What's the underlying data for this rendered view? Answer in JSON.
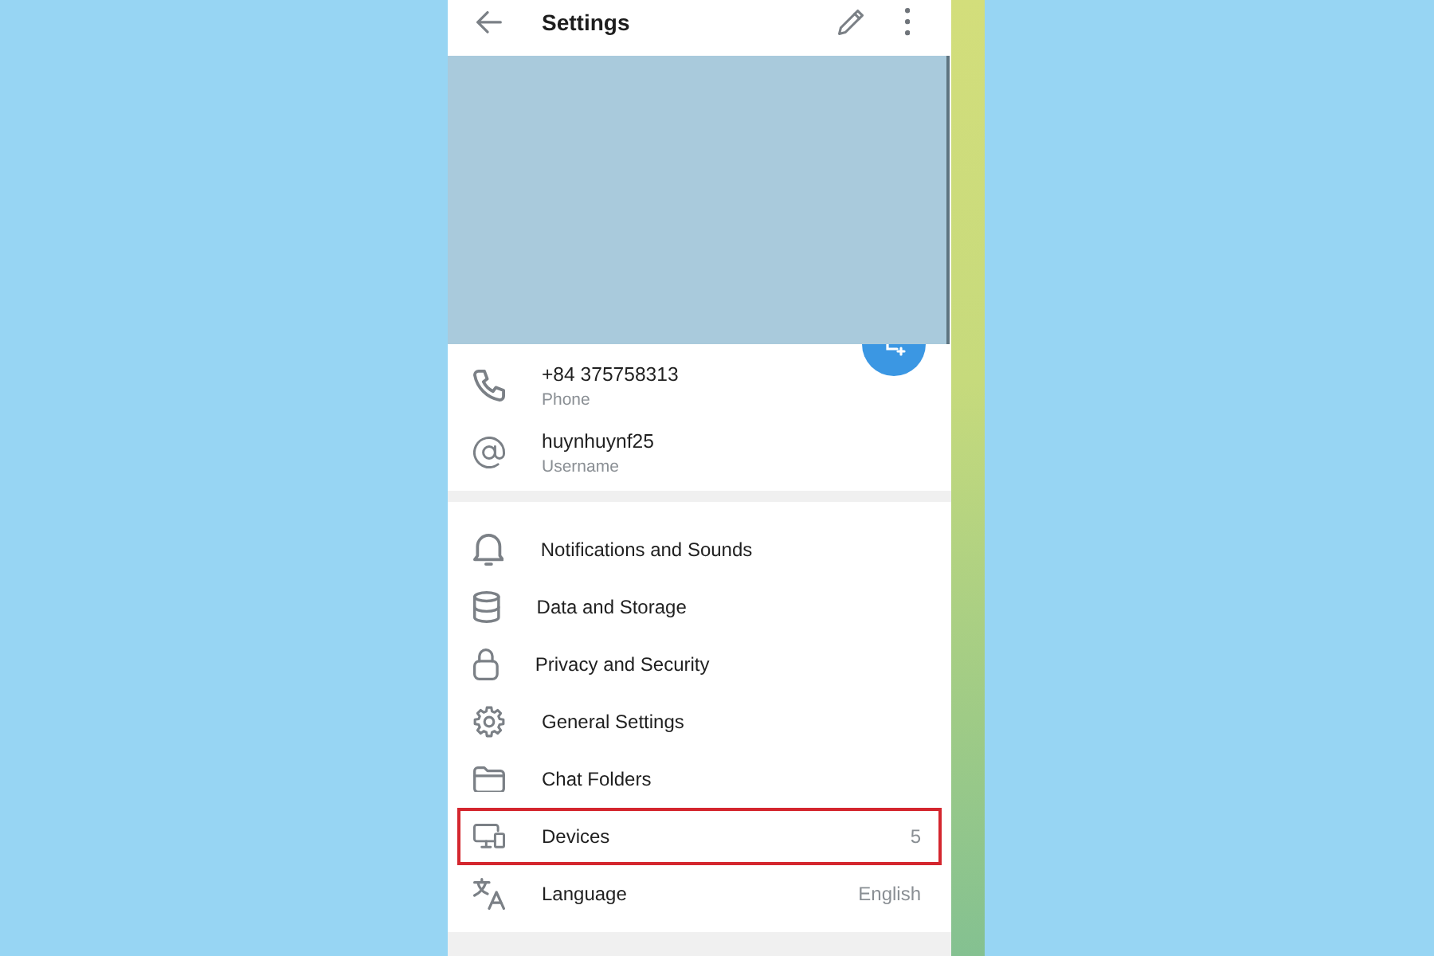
{
  "header": {
    "title": "Settings"
  },
  "profile": {
    "fields": [
      {
        "kind": "phone",
        "value": "+84 375758313",
        "label": "Phone"
      },
      {
        "kind": "username",
        "value": "huynhuynf25",
        "label": "Username"
      }
    ]
  },
  "settings": [
    {
      "kind": "notifications",
      "label": "Notifications and Sounds",
      "highlighted": false
    },
    {
      "kind": "data",
      "label": "Data and Storage",
      "highlighted": false
    },
    {
      "kind": "privacy",
      "label": "Privacy and Security",
      "highlighted": false
    },
    {
      "kind": "general",
      "label": "General Settings",
      "highlighted": false
    },
    {
      "kind": "folders",
      "label": "Chat Folders",
      "highlighted": false
    },
    {
      "kind": "devices",
      "label": "Devices",
      "value": "5",
      "highlighted": true
    },
    {
      "kind": "language",
      "label": "Language",
      "value": "English",
      "highlighted": false
    }
  ]
}
